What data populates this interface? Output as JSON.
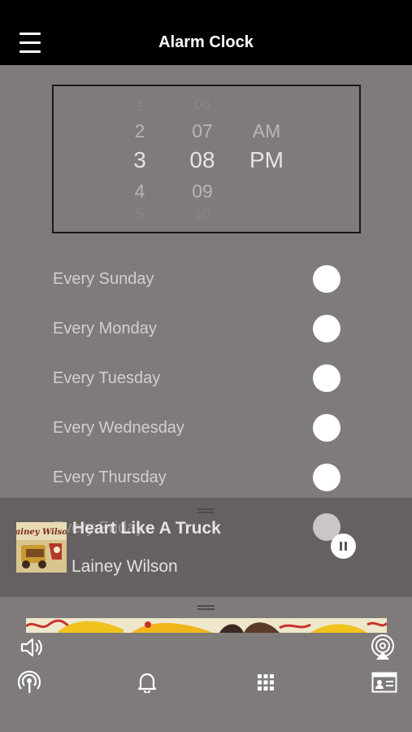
{
  "header": {
    "title": "Alarm Clock",
    "menu_icon": "hamburger-menu-icon"
  },
  "time_picker": {
    "hours": [
      "1",
      "2",
      "3",
      "4",
      "5"
    ],
    "minutes": [
      "06",
      "07",
      "08",
      "09",
      "10"
    ],
    "periods": [
      "AM",
      "PM"
    ],
    "selected_hour": "3",
    "selected_minute": "08",
    "selected_period": "PM"
  },
  "days": [
    {
      "label": "Every Sunday",
      "enabled": false
    },
    {
      "label": "Every Monday",
      "enabled": false
    },
    {
      "label": "Every Tuesday",
      "enabled": false
    },
    {
      "label": "Every Wednesday",
      "enabled": false
    },
    {
      "label": "Every Thursday",
      "enabled": false
    },
    {
      "label": "Every Friday",
      "enabled": false
    }
  ],
  "now_playing": {
    "title": "Heart Like A Truck",
    "artist": "Lainey Wilson",
    "album_art_text": "Lainey Wilson",
    "state": "playing"
  },
  "bottom_bar": {
    "icons": [
      "volume-icon",
      "airplay-icon",
      "radio-podcast-icon",
      "alarm-bell-icon",
      "grid-icon",
      "contact-card-icon"
    ]
  },
  "colors": {
    "header_bg": "#000000",
    "page_bg": "#7f7b7a",
    "toggle": "#ffffff"
  }
}
